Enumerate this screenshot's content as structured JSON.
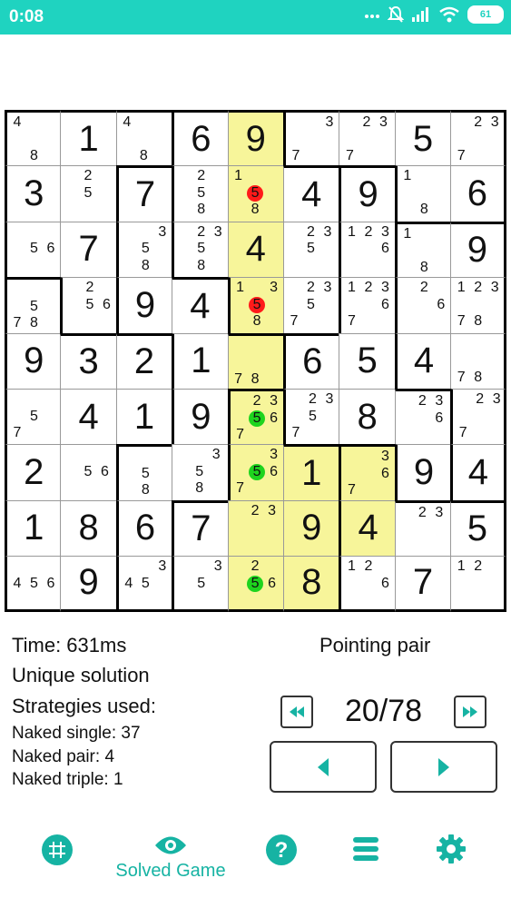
{
  "status_bar": {
    "time": "0:08",
    "battery": "61"
  },
  "grid": {
    "highlight_color": "#f7f59a",
    "highlight_cells": [
      [
        0,
        4
      ],
      [
        1,
        4
      ],
      [
        2,
        4
      ],
      [
        3,
        4
      ],
      [
        4,
        4
      ],
      [
        5,
        4
      ],
      [
        6,
        4
      ],
      [
        7,
        4
      ],
      [
        8,
        4
      ],
      [
        6,
        5
      ],
      [
        7,
        5
      ],
      [
        8,
        5
      ],
      [
        6,
        6
      ],
      [
        7,
        6
      ]
    ],
    "cells": [
      [
        {
          "c": [
            "4",
            "8"
          ],
          "p": [
            1,
            8
          ]
        },
        {
          "v": "1"
        },
        {
          "c": [
            "4",
            "8"
          ],
          "p": [
            1,
            8
          ]
        },
        {
          "v": "6"
        },
        {
          "v": "9"
        },
        {
          "c": [
            "3",
            "7"
          ],
          "p": [
            3,
            7
          ]
        },
        {
          "c": [
            "2",
            "3",
            "7"
          ],
          "p": [
            2,
            3,
            7
          ]
        },
        {
          "v": "5"
        },
        {
          "c": [
            "2",
            "3",
            "7"
          ],
          "p": [
            2,
            3,
            7
          ]
        }
      ],
      [
        {
          "v": "3"
        },
        {
          "c": [
            "2",
            "5"
          ],
          "p": [
            2,
            5
          ]
        },
        {
          "v": "7"
        },
        {
          "c": [
            "2",
            "5",
            "8"
          ],
          "p": [
            2,
            5,
            8
          ]
        },
        {
          "c": [
            "1",
            "5",
            "8"
          ],
          "p": [
            1,
            5,
            8
          ],
          "red": [
            "5"
          ]
        },
        {
          "v": "4"
        },
        {
          "v": "9"
        },
        {
          "c": [
            "1",
            "8"
          ],
          "p": [
            1,
            8
          ]
        },
        {
          "v": "6"
        }
      ],
      [
        {
          "c": [
            "5",
            "6"
          ],
          "p": [
            5,
            6
          ]
        },
        {
          "v": "7"
        },
        {
          "c": [
            "3",
            "5",
            "8"
          ],
          "p": [
            3,
            5,
            8
          ]
        },
        {
          "c": [
            "2",
            "3",
            "5",
            "8"
          ],
          "p": [
            2,
            3,
            5,
            8
          ]
        },
        {
          "v": "4"
        },
        {
          "c": [
            "2",
            "3",
            "5"
          ],
          "p": [
            2,
            3,
            5
          ]
        },
        {
          "c": [
            "1",
            "2",
            "3",
            "6"
          ],
          "p": [
            1,
            2,
            3,
            6
          ]
        },
        {
          "c": [
            "1",
            "8"
          ],
          "p": [
            1,
            8
          ]
        },
        {
          "v": "9"
        }
      ],
      [
        {
          "c": [
            "5",
            "7",
            "8"
          ],
          "p": [
            5,
            7,
            8
          ]
        },
        {
          "c": [
            "2",
            "5",
            "6"
          ],
          "p": [
            2,
            5,
            6
          ]
        },
        {
          "v": "9"
        },
        {
          "v": "4"
        },
        {
          "c": [
            "1",
            "3",
            "5",
            "8"
          ],
          "p": [
            1,
            3,
            5,
            8
          ],
          "red": [
            "5"
          ]
        },
        {
          "c": [
            "2",
            "3",
            "5",
            "7"
          ],
          "p": [
            2,
            3,
            5,
            7
          ]
        },
        {
          "c": [
            "1",
            "2",
            "3",
            "6",
            "7"
          ],
          "p": [
            1,
            2,
            3,
            6,
            7
          ]
        },
        {
          "c": [
            "2",
            "6"
          ],
          "p": [
            2,
            6
          ]
        },
        {
          "c": [
            "1",
            "2",
            "3",
            "7",
            "8"
          ],
          "p": [
            1,
            2,
            3,
            7,
            8
          ]
        }
      ],
      [
        {
          "v": "9"
        },
        {
          "v": "3"
        },
        {
          "v": "2"
        },
        {
          "v": "1"
        },
        {
          "c": [
            "7",
            "8"
          ],
          "p": [
            7,
            8
          ]
        },
        {
          "v": "6"
        },
        {
          "v": "5"
        },
        {
          "v": "4"
        },
        {
          "c": [
            "7",
            "8"
          ],
          "p": [
            7,
            8
          ]
        }
      ],
      [
        {
          "c": [
            "5",
            "7"
          ],
          "p": [
            5,
            7
          ]
        },
        {
          "v": "4"
        },
        {
          "v": "1"
        },
        {
          "v": "9"
        },
        {
          "c": [
            "2",
            "3",
            "5",
            "6",
            "7"
          ],
          "p": [
            2,
            3,
            5,
            6,
            7
          ],
          "green": [
            "5"
          ]
        },
        {
          "c": [
            "2",
            "3",
            "5",
            "7"
          ],
          "p": [
            2,
            3,
            5,
            7
          ]
        },
        {
          "v": "8"
        },
        {
          "c": [
            "2",
            "3",
            "6"
          ],
          "p": [
            2,
            3,
            6
          ]
        },
        {
          "c": [
            "2",
            "3",
            "7"
          ],
          "p": [
            2,
            3,
            7
          ]
        }
      ],
      [
        {
          "v": "2"
        },
        {
          "c": [
            "5",
            "6"
          ],
          "p": [
            5,
            6
          ]
        },
        {
          "c": [
            "5",
            "8"
          ],
          "p": [
            5,
            8
          ]
        },
        {
          "c": [
            "3",
            "5",
            "8"
          ],
          "p": [
            3,
            5,
            8
          ]
        },
        {
          "c": [
            "3",
            "5",
            "6",
            "7"
          ],
          "p": [
            3,
            5,
            6,
            7
          ],
          "green": [
            "5"
          ]
        },
        {
          "v": "1"
        },
        {
          "c": [
            "3",
            "6",
            "7"
          ],
          "p": [
            3,
            6,
            7
          ]
        },
        {
          "v": "9"
        },
        {
          "v": "4"
        }
      ],
      [
        {
          "v": "1"
        },
        {
          "v": "8"
        },
        {
          "v": "6"
        },
        {
          "v": "7"
        },
        {
          "c": [
            "2",
            "3"
          ],
          "p": [
            2,
            3
          ]
        },
        {
          "v": "9"
        },
        {
          "v": "4"
        },
        {
          "c": [
            "2",
            "3"
          ],
          "p": [
            2,
            3
          ]
        },
        {
          "v": "5"
        }
      ],
      [
        {
          "c": [
            "4",
            "5",
            "6"
          ],
          "p": [
            4,
            5,
            6
          ]
        },
        {
          "v": "9"
        },
        {
          "c": [
            "3",
            "4",
            "5"
          ],
          "p": [
            3,
            4,
            5
          ]
        },
        {
          "c": [
            "3",
            "5"
          ],
          "p": [
            3,
            5
          ]
        },
        {
          "c": [
            "2",
            "5",
            "6"
          ],
          "p": [
            2,
            5,
            6
          ],
          "green": [
            "5"
          ]
        },
        {
          "v": "8"
        },
        {
          "c": [
            "1",
            "2",
            "6"
          ],
          "p": [
            1,
            2,
            6
          ]
        },
        {
          "v": "7"
        },
        {
          "c": [
            "1",
            "2"
          ],
          "p": [
            1,
            2
          ]
        }
      ]
    ],
    "regions": [
      [
        0,
        0,
        0,
        1,
        1,
        2,
        2,
        2,
        2
      ],
      [
        0,
        0,
        3,
        1,
        1,
        1,
        4,
        2,
        2
      ],
      [
        0,
        0,
        3,
        1,
        1,
        1,
        4,
        5,
        5
      ],
      [
        6,
        0,
        3,
        3,
        1,
        1,
        4,
        5,
        5
      ],
      [
        6,
        6,
        6,
        3,
        3,
        4,
        4,
        5,
        5
      ],
      [
        6,
        6,
        6,
        3,
        7,
        4,
        4,
        4,
        5
      ],
      [
        6,
        6,
        3,
        3,
        7,
        7,
        8,
        4,
        5
      ],
      [
        6,
        6,
        3,
        7,
        7,
        7,
        8,
        8,
        8
      ],
      [
        6,
        6,
        3,
        7,
        7,
        7,
        8,
        8,
        8
      ]
    ]
  },
  "info": {
    "time": "Time: 631ms",
    "solution": "Unique solution",
    "strategies_header": "Strategies used:",
    "strategies": [
      "Naked single: 37",
      "Naked pair: 4",
      "Naked triple: 1"
    ],
    "strategy_name": "Pointing pair",
    "step_counter": "20/78"
  },
  "controls": {
    "first_icon": "double-left-arrow-icon",
    "last_icon": "double-right-arrow-icon",
    "prev_icon": "left-triangle-icon",
    "next_icon": "right-triangle-icon",
    "accent": "#16b3a3"
  },
  "bottom_nav": {
    "items": [
      {
        "icon": "grid-icon",
        "label": ""
      },
      {
        "icon": "eye-icon",
        "label": "Solved Game"
      },
      {
        "icon": "help-icon",
        "label": ""
      },
      {
        "icon": "menu-icon",
        "label": ""
      },
      {
        "icon": "gear-icon",
        "label": ""
      }
    ]
  }
}
